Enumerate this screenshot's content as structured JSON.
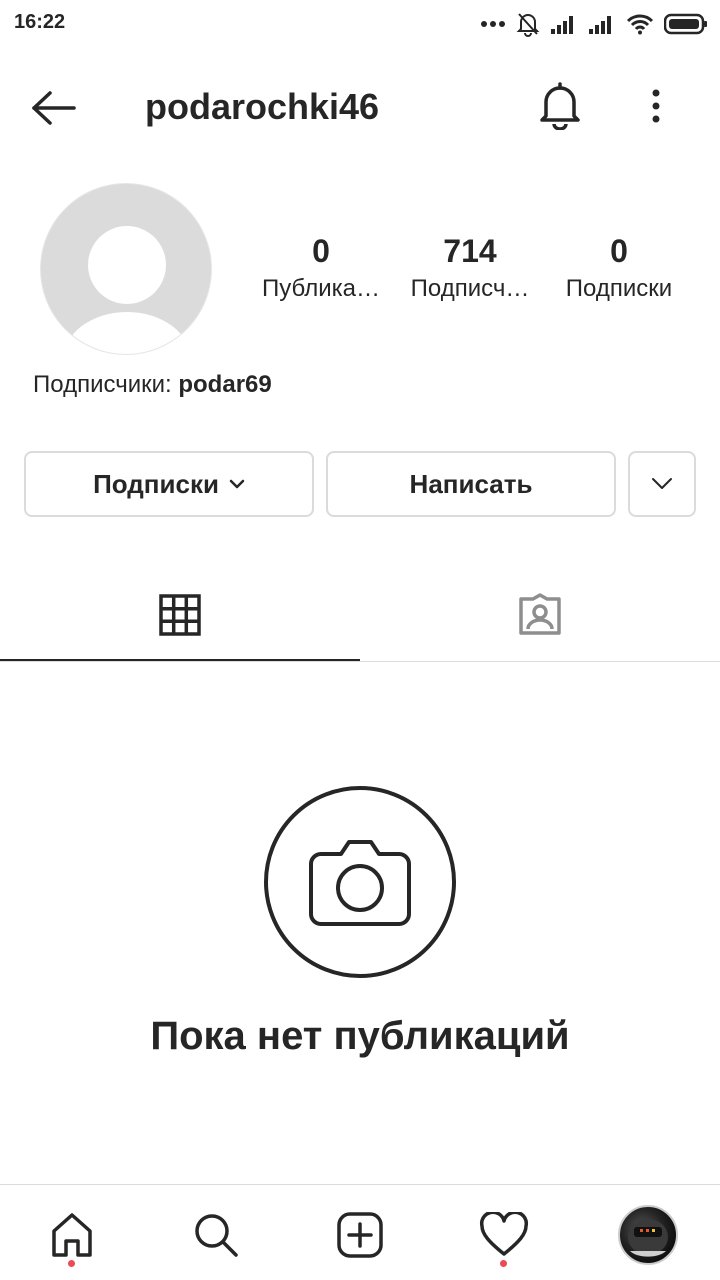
{
  "status_bar": {
    "time": "16:22"
  },
  "header": {
    "username": "podarochki46"
  },
  "profile": {
    "stats": [
      {
        "value": "0",
        "label": "Публика…"
      },
      {
        "value": "714",
        "label": "Подписч…"
      },
      {
        "value": "0",
        "label": "Подписки"
      }
    ],
    "followed_by_prefix": "Подписчики: ",
    "followed_by_user": "podar69"
  },
  "actions": {
    "following_label": "Подписки",
    "message_label": "Написать"
  },
  "empty_state": {
    "text": "Пока нет публикаций"
  },
  "colors": {
    "text": "#262626",
    "border": "#dbdbdb",
    "notification_dot": "#ed4956",
    "avatar_placeholder": "#dbdbdb"
  },
  "icons": [
    "back-arrow-icon",
    "bell-icon",
    "more-vertical-icon",
    "chevron-down-icon",
    "grid-icon",
    "tagged-icon",
    "camera-icon",
    "home-icon",
    "search-icon",
    "add-post-icon",
    "heart-icon"
  ]
}
